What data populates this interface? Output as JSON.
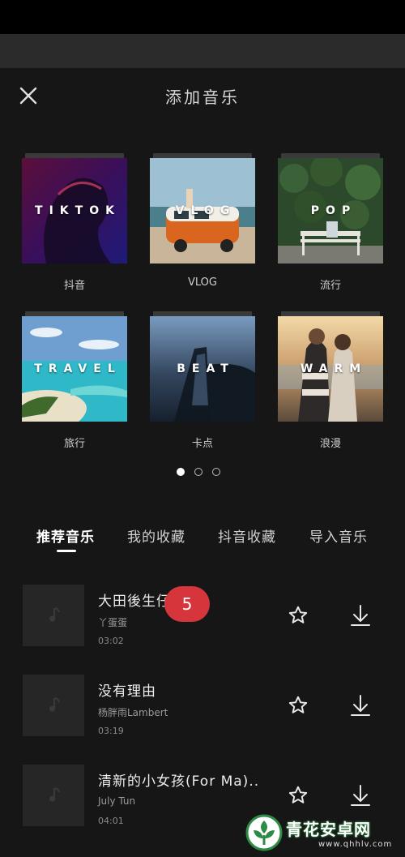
{
  "header": {
    "title": "添加音乐"
  },
  "categories": [
    {
      "overlay": "TIKTOK",
      "label": "抖音"
    },
    {
      "overlay": "VLOG",
      "label": "VLOG"
    },
    {
      "overlay": "POP",
      "label": "流行"
    },
    {
      "overlay": "TRAVEL",
      "label": "旅行"
    },
    {
      "overlay": "BEAT",
      "label": "卡点"
    },
    {
      "overlay": "WARM",
      "label": "浪漫"
    }
  ],
  "pager": {
    "page_count": 3,
    "active_index": 0
  },
  "tabs": [
    {
      "label": "推荐音乐",
      "active": true
    },
    {
      "label": "我的收藏",
      "active": false
    },
    {
      "label": "抖音收藏",
      "active": false
    },
    {
      "label": "导入音乐",
      "active": false
    }
  ],
  "songs": [
    {
      "title": "大田後生仔",
      "artist": "丫蛋蛋",
      "duration": "03:02"
    },
    {
      "title": "没有理由",
      "artist": "杨胖雨Lambert",
      "duration": "03:19"
    },
    {
      "title": "清新的小女孩(For Ma)...",
      "artist": "July Tun",
      "duration": "04:01"
    }
  ],
  "badge": {
    "count": "5"
  },
  "watermark": {
    "name": "青花安卓网",
    "url": "www.qhhlv.com"
  },
  "colors": {
    "background": "#161616",
    "badge": "#d6363b",
    "accent_text": "#ffffff"
  }
}
